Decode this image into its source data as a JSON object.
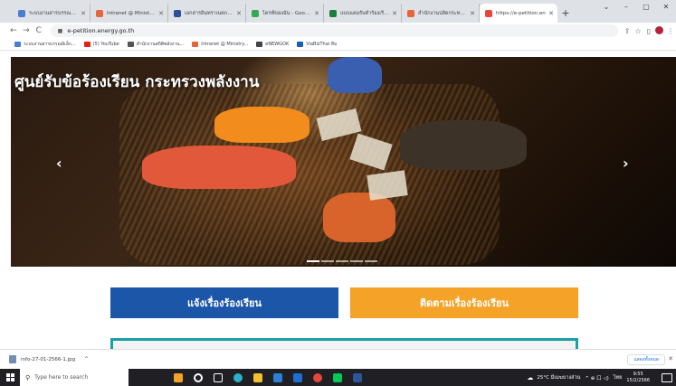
{
  "browser": {
    "tabs": [
      {
        "title": "ระบบงานสารบรรณอิเล็กฯ",
        "color": "#4a7fd0"
      },
      {
        "title": "Intranet @ Ministry Of",
        "color": "#e8653a"
      },
      {
        "title": "เอกสารอินทราเนตกระทรวง",
        "color": "#2b4f9a"
      },
      {
        "title": "ไดรฟ์ของฉัน - Google ไดรฟ์",
        "color": "#34a853"
      },
      {
        "title": "แบบแผนรับคำร้องเรียน",
        "color": "#188038"
      },
      {
        "title": "สำนักงานปลัดกระทรวง",
        "color": "#e8653a"
      },
      {
        "title": "https://e-petition.en",
        "color": "#e8453c"
      }
    ],
    "new_tab_label": "+",
    "window_controls": [
      "⌄",
      "–",
      "▢",
      "✕"
    ],
    "nav": {
      "back": "←",
      "forward": "→",
      "reload": "C"
    },
    "url": "e-petition.energy.go.th",
    "toolbar_icons": [
      "share-icon",
      "star-icon",
      "sidepanel-icon",
      "profile-icon",
      "menu-icon"
    ],
    "toolbar_glyphs": {
      "share": "⇪",
      "star": "☆",
      "sidepanel": "▯",
      "menu": "⋮"
    },
    "bookmarks": [
      {
        "label": "ระบบงานสารบรรณอิเล็ก...",
        "color": "#4a7fd0"
      },
      {
        "label": "(5) YouTube",
        "color": "#e62117"
      },
      {
        "label": "สำนักงานสถิติพลังงาน...",
        "color": "#555555"
      },
      {
        "label": "Intranet @ Ministry...",
        "color": "#e8653a"
      },
      {
        "label": "eNEWGOK",
        "color": "#444444"
      },
      {
        "label": "ViaBizThai ทีม",
        "color": "#1a5fb4"
      }
    ]
  },
  "page": {
    "hero_title": "ศูนย์รับข้อร้องเรียน กระทรวงพลังงาน",
    "carousel": {
      "prev": "‹",
      "next": "›",
      "slide_count": 5,
      "active_slide": 1
    },
    "buttons": {
      "report": "แจ้งเรื่องร้องเรียน",
      "track": "ติดตามเรื่องร้องเรียน"
    },
    "colors": {
      "report": "#1c56a8",
      "track": "#f4a328",
      "panel_border": "#17a0a5"
    }
  },
  "downloads": {
    "file_name": "info-27-01-2566-1.jpg",
    "caret": "^",
    "show_all": "แสดงทั้งหมด",
    "close": "✕"
  },
  "taskbar": {
    "search_placeholder": "Type here to search",
    "weather": "25°C มีเมฆบางส่วน",
    "tray_symbols": "^ ⊕ 口 ◁)",
    "language": "ไทย",
    "time": "9:55",
    "date": "15/2/2566"
  }
}
